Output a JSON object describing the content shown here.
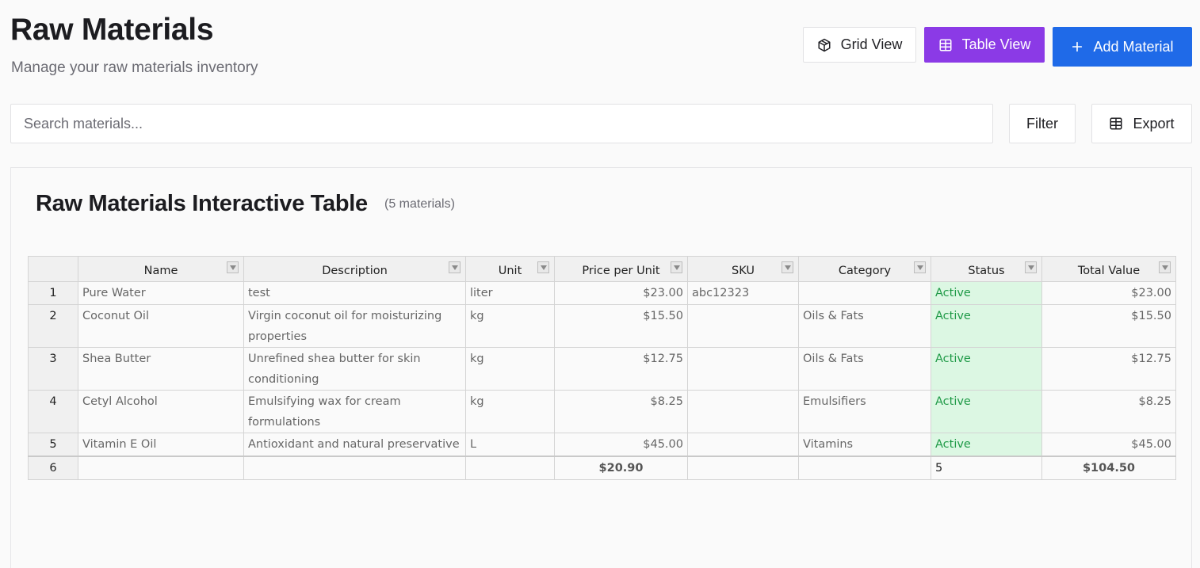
{
  "header": {
    "title": "Raw Materials",
    "subtitle": "Manage your raw materials inventory",
    "grid_view_label": "Grid View",
    "table_view_label": "Table View",
    "add_material_label": "Add Material"
  },
  "toolbar": {
    "search_placeholder": "Search materials...",
    "filter_label": "Filter",
    "export_label": "Export"
  },
  "card": {
    "title": "Raw Materials Interactive Table",
    "count": "(5 materials)"
  },
  "table": {
    "columns": [
      "Name",
      "Description",
      "Unit",
      "Price per Unit",
      "SKU",
      "Category",
      "Status",
      "Total Value"
    ],
    "rows": [
      {
        "num": "1",
        "name": "Pure Water",
        "description": "test",
        "unit": "liter",
        "price": "$23.00",
        "sku": "abc12323",
        "category": "",
        "status": "Active",
        "total": "$23.00"
      },
      {
        "num": "2",
        "name": "Coconut Oil",
        "description": "Virgin coconut oil for moisturizing properties",
        "unit": "kg",
        "price": "$15.50",
        "sku": "",
        "category": "Oils & Fats",
        "status": "Active",
        "total": "$15.50"
      },
      {
        "num": "3",
        "name": "Shea Butter",
        "description": "Unrefined shea butter for skin conditioning",
        "unit": "kg",
        "price": "$12.75",
        "sku": "",
        "category": "Oils & Fats",
        "status": "Active",
        "total": "$12.75"
      },
      {
        "num": "4",
        "name": "Cetyl Alcohol",
        "description": "Emulsifying wax for cream formulations",
        "unit": "kg",
        "price": "$8.25",
        "sku": "",
        "category": "Emulsifiers",
        "status": "Active",
        "total": "$8.25"
      },
      {
        "num": "5",
        "name": "Vitamin E Oil",
        "description": "Antioxidant and natural preservative",
        "unit": "L",
        "price": "$45.00",
        "sku": "",
        "category": "Vitamins",
        "status": "Active",
        "total": "$45.00"
      }
    ],
    "summary": {
      "num": "6",
      "price": "$20.90",
      "status": "5",
      "total": "$104.50"
    }
  },
  "colors": {
    "accent_purple": "#8b3ae6",
    "accent_blue": "#1f6ae8",
    "status_green_bg": "#dcf7e3",
    "status_green_text": "#1f9a47"
  },
  "icons": {
    "grid_view": "cube-icon",
    "table_view": "table-icon",
    "add": "plus-icon",
    "export": "table-icon",
    "filter": "filter-dropdown-icon"
  }
}
